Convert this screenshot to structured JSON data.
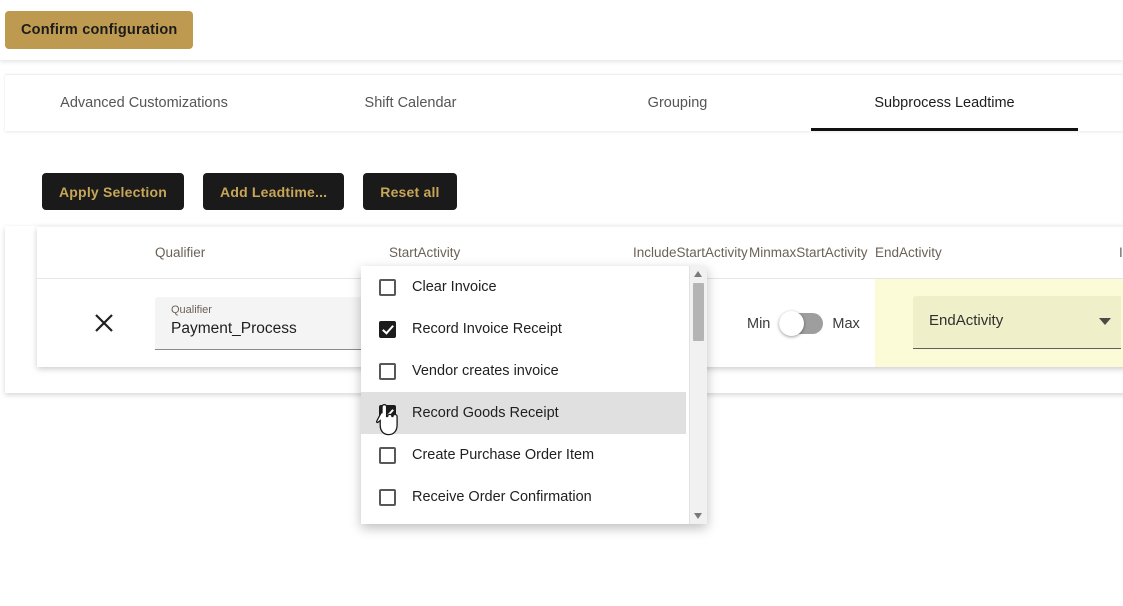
{
  "topbar": {
    "confirm_label": "Confirm configuration"
  },
  "tabs": [
    {
      "label": "Advanced Customizations",
      "active": false
    },
    {
      "label": "Shift Calendar",
      "active": false
    },
    {
      "label": "Grouping",
      "active": false
    },
    {
      "label": "Subprocess Leadtime",
      "active": true
    }
  ],
  "actions": {
    "apply_label": "Apply Selection",
    "add_label": "Add Leadtime...",
    "reset_label": "Reset all"
  },
  "table": {
    "headers": {
      "qualifier": "Qualifier",
      "start_activity": "StartActivity",
      "include_start_activity": "IncludeStartActivity",
      "minmax_start_activity": "MinmaxStartActivity",
      "end_activity": "EndActivity",
      "include_end_activity": "I"
    },
    "row": {
      "qualifier_label": "Qualifier",
      "qualifier_value": "Payment_Process",
      "minmax_min_label": "Min",
      "minmax_max_label": "Max",
      "minmax_selected": "Min",
      "end_activity_value": "EndActivity"
    }
  },
  "dropdown": {
    "items": [
      {
        "label": "Clear Invoice",
        "checked": false,
        "hovered": false
      },
      {
        "label": "Record Invoice Receipt",
        "checked": true,
        "hovered": false
      },
      {
        "label": "Vendor creates invoice",
        "checked": false,
        "hovered": false
      },
      {
        "label": "Record Goods Receipt",
        "checked": true,
        "hovered": true
      },
      {
        "label": "Create Purchase Order Item",
        "checked": false,
        "hovered": false
      },
      {
        "label": "Receive Order Confirmation",
        "checked": false,
        "hovered": false
      }
    ]
  },
  "colors": {
    "gold": "#bd9a50",
    "dark_button": "#1a1a1a",
    "button_text_gold": "#c8a658",
    "autofill_yellow": "#fbfbd7",
    "active_tab_underline": "#111111"
  }
}
